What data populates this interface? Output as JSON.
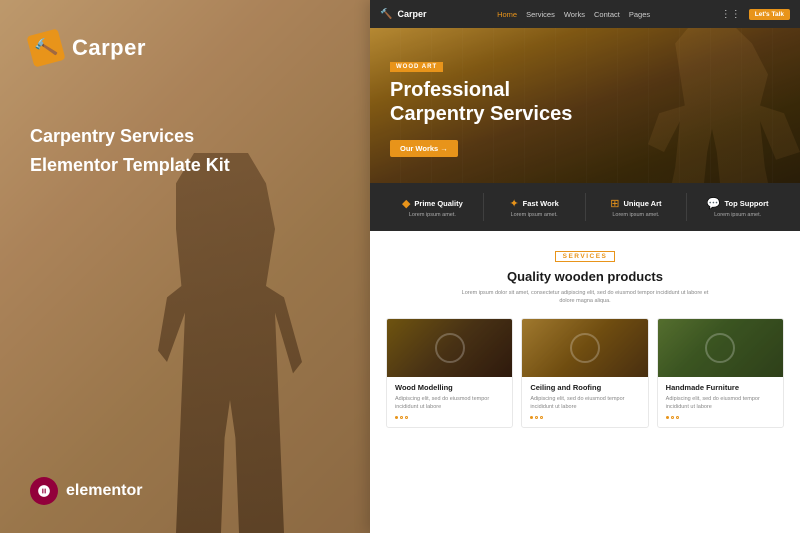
{
  "left": {
    "brand": {
      "icon": "🔨",
      "name": "Carper"
    },
    "tagline_line1": "Carpentry Services",
    "tagline_line2": "Elementor Template Kit",
    "elementor": {
      "icon": "e",
      "label": "elementor"
    }
  },
  "site": {
    "nav": {
      "brand": "Carper",
      "brand_icon": "🔨",
      "links": [
        "Home",
        "Services",
        "Works",
        "Contact",
        "Pages"
      ],
      "active": "Home",
      "cta": "Let's Talk"
    },
    "hero": {
      "tag": "WOOD ART",
      "title_line1": "Professional",
      "title_line2": "Carpentry Services",
      "cta_button": "Our Works →"
    },
    "features": [
      {
        "icon": "◆",
        "title": "Prime Quality",
        "desc": "Lorem ipsum amet."
      },
      {
        "icon": "✦",
        "title": "Fast Work",
        "desc": "Lorem ipsum amet."
      },
      {
        "icon": "⊞",
        "title": "Unique Art",
        "desc": "Lorem ipsum amet."
      },
      {
        "icon": "💬",
        "title": "Top Support",
        "desc": "Lorem ipsum amet."
      }
    ],
    "products_section": {
      "tag": "SERVICES",
      "title": "Quality wooden products",
      "desc": "Lorem ipsum dolor sit amet, consectetur adipiscing elit, sed do eiusmod tempor incididunt ut labore et dolore magna aliqua.",
      "cards": [
        {
          "title": "Wood Modelling",
          "desc": "Adipiscing elit, sed do eiusmod tempor incididunt ut labore"
        },
        {
          "title": "Ceiling and Roofing",
          "desc": "Adipiscing elit, sed do eiusmod tempor incididunt ut labore"
        },
        {
          "title": "Handmade Furniture",
          "desc": "Adipiscing elit, sed do eiusmod tempor incididunt ut labore"
        }
      ]
    }
  }
}
